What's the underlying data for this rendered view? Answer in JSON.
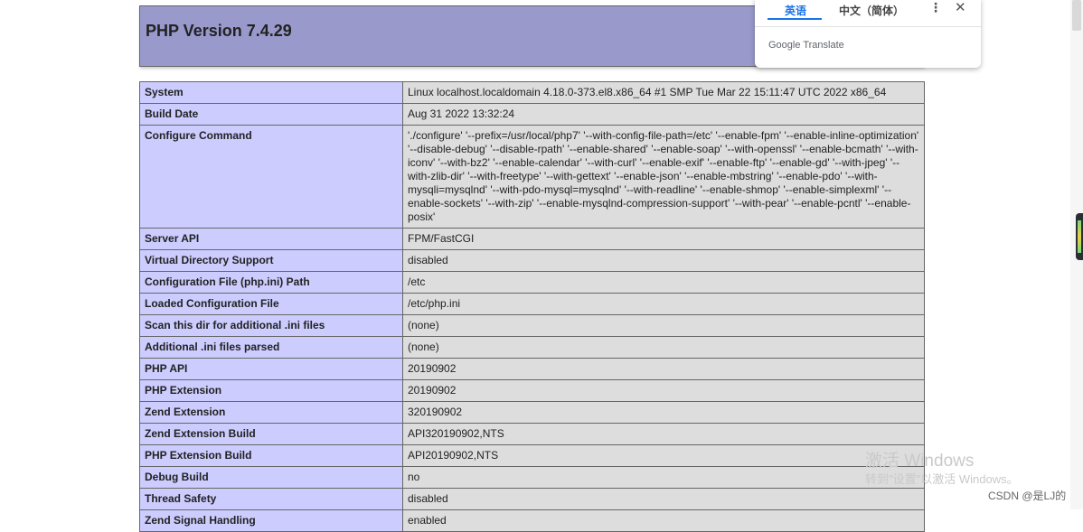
{
  "page": {
    "title": "PHP Version 7.4.29"
  },
  "info_rows": [
    {
      "key": "System",
      "value": "Linux localhost.localdomain 4.18.0-373.el8.x86_64 #1 SMP Tue Mar 22 15:11:47 UTC 2022 x86_64"
    },
    {
      "key": "Build Date",
      "value": "Aug 31 2022 13:32:24"
    },
    {
      "key": "Configure Command",
      "value": "'./configure' '--prefix=/usr/local/php7' '--with-config-file-path=/etc' '--enable-fpm' '--enable-inline-optimization' '--disable-debug' '--disable-rpath' '--enable-shared' '--enable-soap' '--with-openssl' '--enable-bcmath' '--with-iconv' '--with-bz2' '--enable-calendar' '--with-curl' '--enable-exif' '--enable-ftp' '--enable-gd' '--with-jpeg' '--with-zlib-dir' '--with-freetype' '--with-gettext' '--enable-json' '--enable-mbstring' '--enable-pdo' '--with-mysqli=mysqlnd' '--with-pdo-mysql=mysqlnd' '--with-readline' '--enable-shmop' '--enable-simplexml' '--enable-sockets' '--with-zip' '--enable-mysqlnd-compression-support' '--with-pear' '--enable-pcntl' '--enable-posix'"
    },
    {
      "key": "Server API",
      "value": "FPM/FastCGI"
    },
    {
      "key": "Virtual Directory Support",
      "value": "disabled"
    },
    {
      "key": "Configuration File (php.ini) Path",
      "value": "/etc"
    },
    {
      "key": "Loaded Configuration File",
      "value": "/etc/php.ini"
    },
    {
      "key": "Scan this dir for additional .ini files",
      "value": "(none)"
    },
    {
      "key": "Additional .ini files parsed",
      "value": "(none)"
    },
    {
      "key": "PHP API",
      "value": "20190902"
    },
    {
      "key": "PHP Extension",
      "value": "20190902"
    },
    {
      "key": "Zend Extension",
      "value": "320190902"
    },
    {
      "key": "Zend Extension Build",
      "value": "API320190902,NTS"
    },
    {
      "key": "PHP Extension Build",
      "value": "API20190902,NTS"
    },
    {
      "key": "Debug Build",
      "value": "no"
    },
    {
      "key": "Thread Safety",
      "value": "disabled"
    },
    {
      "key": "Zend Signal Handling",
      "value": "enabled"
    }
  ],
  "translate_popup": {
    "tab_active": "英语",
    "tab_inactive": "中文（简体）",
    "brand": "Google Translate",
    "menu_icon": "more-vert-icon",
    "close_icon": "close-icon"
  },
  "overlay": {
    "watermark_line1": "激活 Windows",
    "watermark_line2": "转到\"设置\"以激活 Windows。",
    "csdn_tag": "CSDN @是LJ的"
  }
}
